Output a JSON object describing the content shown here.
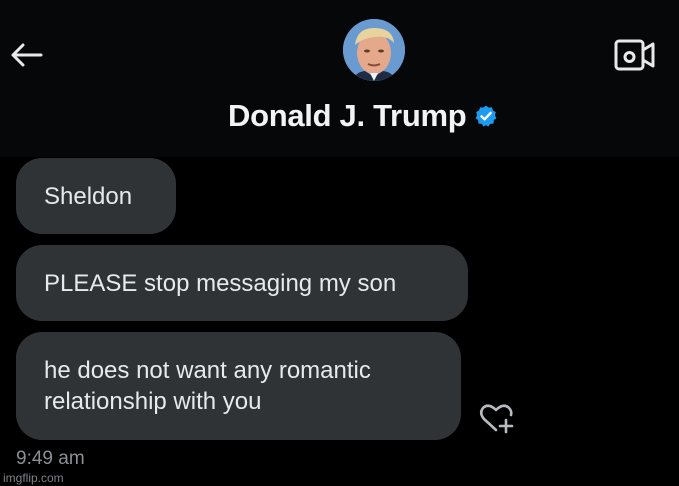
{
  "header": {
    "back_icon": "arrow-left-icon",
    "video_icon": "video-camera-icon",
    "contact_name": "Donald J. Trump",
    "verified_icon": "verified-badge-icon",
    "verified_color": "#1d9bf0"
  },
  "messages": [
    {
      "text": "Sheldon"
    },
    {
      "text": "PLEASE stop messaging my son"
    },
    {
      "line1": "he does not want any romantic",
      "line2": "relationship with you"
    }
  ],
  "reaction": {
    "icon": "heart-plus-icon"
  },
  "timestamp": "9:49 am",
  "watermark": "imgflip.com",
  "colors": {
    "background": "#000000",
    "bubble": "#2f3336",
    "text": "#e7e9ea",
    "muted": "#8b9096"
  }
}
